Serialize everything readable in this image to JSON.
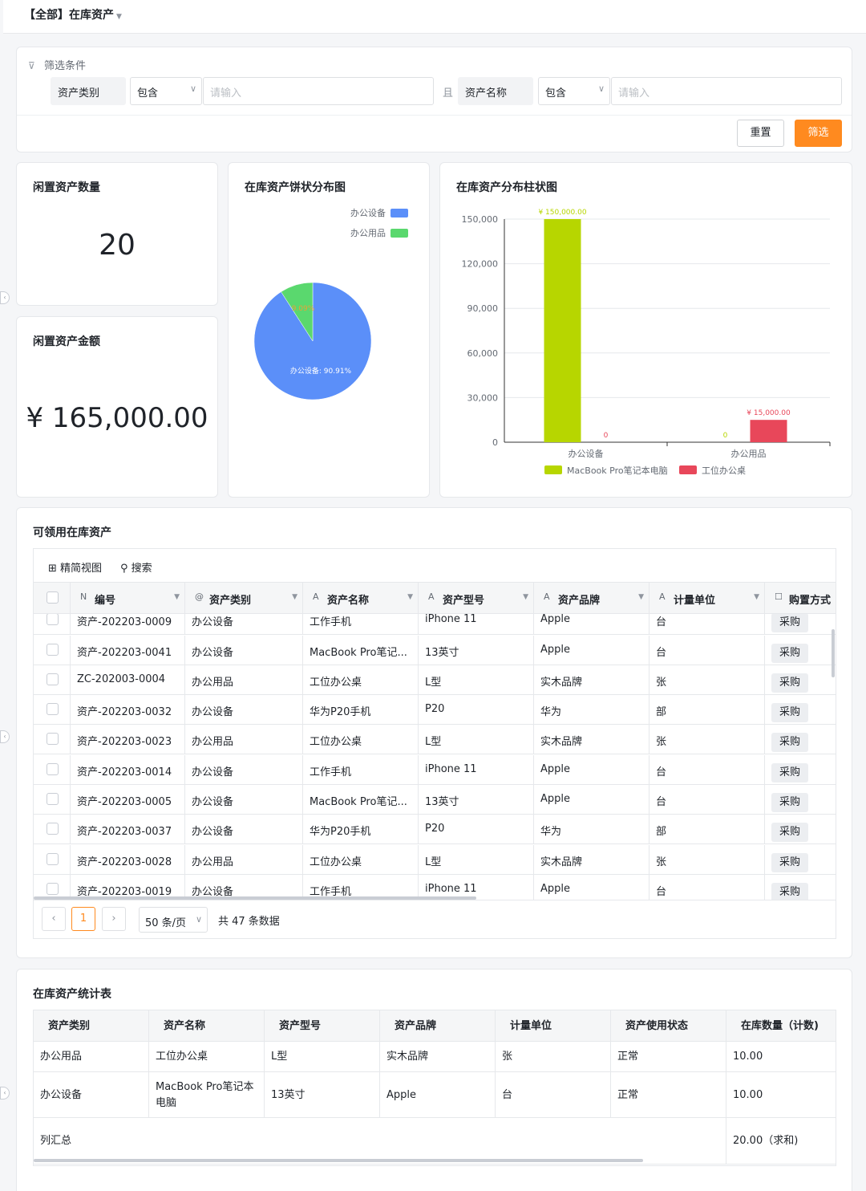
{
  "page": {
    "title": "【全部】在库资产"
  },
  "filter": {
    "label": "筛选条件",
    "connector": "且",
    "conditions": [
      {
        "field": "资产类别",
        "operator": "包含",
        "placeholder": "请输入"
      },
      {
        "field": "资产名称",
        "operator": "包含",
        "placeholder": "请输入"
      }
    ],
    "reset_label": "重置",
    "apply_label": "筛选"
  },
  "kpis": {
    "idle_count": {
      "title": "闲置资产数量",
      "value": "20"
    },
    "idle_amount": {
      "title": "闲置资产金额",
      "value": "¥ 165,000.00"
    }
  },
  "pie": {
    "title": "在库资产饼状分布图",
    "chart_data": {
      "type": "pie",
      "slices": [
        {
          "name": "办公设备",
          "value": 90.91,
          "label": "办公设备: 90.91%",
          "color": "#5b8ff9"
        },
        {
          "name": "办公用品",
          "value": 9.09,
          "label": "9.09%",
          "color": "#5ad86e"
        }
      ],
      "legend_position": "top-right"
    }
  },
  "bar": {
    "title": "在库资产分布柱状图",
    "chart_data": {
      "type": "bar",
      "categories": [
        "办公设备",
        "办公用品"
      ],
      "series": [
        {
          "name": "MacBook Pro笔记本电脑",
          "values": [
            150000,
            0
          ],
          "labels": [
            "¥ 150,000.00",
            "0"
          ],
          "color": "#b7d600"
        },
        {
          "name": "工位办公桌",
          "values": [
            0,
            15000
          ],
          "labels": [
            "0",
            "¥ 15,000.00"
          ],
          "color": "#e8475a"
        }
      ],
      "ylim": [
        0,
        150000
      ],
      "yticks": [
        "0",
        "30,000",
        "60,000",
        "90,000",
        "120,000",
        "150,000"
      ],
      "grid": true,
      "legend_position": "bottom"
    }
  },
  "available": {
    "title": "可领用在库资产",
    "toolbar": {
      "view_label": "精简视图",
      "search_label": "搜索"
    },
    "columns": [
      "编号",
      "资产类别",
      "资产名称",
      "资产型号",
      "资产品牌",
      "计量单位",
      "购置方式"
    ],
    "rows": [
      [
        "资产-202203-0009",
        "办公设备",
        "工作手机",
        "iPhone 11",
        "Apple",
        "台",
        "采购"
      ],
      [
        "资产-202203-0041",
        "办公设备",
        "MacBook Pro笔记...",
        "13英寸",
        "Apple",
        "台",
        "采购"
      ],
      [
        "ZC-202003-0004",
        "办公用品",
        "工位办公桌",
        "L型",
        "实木品牌",
        "张",
        "采购"
      ],
      [
        "资产-202203-0032",
        "办公设备",
        "华为P20手机",
        "P20",
        "华为",
        "部",
        "采购"
      ],
      [
        "资产-202203-0023",
        "办公用品",
        "工位办公桌",
        "L型",
        "实木品牌",
        "张",
        "采购"
      ],
      [
        "资产-202203-0014",
        "办公设备",
        "工作手机",
        "iPhone 11",
        "Apple",
        "台",
        "采购"
      ],
      [
        "资产-202203-0005",
        "办公设备",
        "MacBook Pro笔记...",
        "13英寸",
        "Apple",
        "台",
        "采购"
      ],
      [
        "资产-202203-0037",
        "办公设备",
        "华为P20手机",
        "P20",
        "华为",
        "部",
        "采购"
      ],
      [
        "资产-202203-0028",
        "办公用品",
        "工位办公桌",
        "L型",
        "实木品牌",
        "张",
        "采购"
      ],
      [
        "资产-202203-0019",
        "办公设备",
        "工作手机",
        "iPhone 11",
        "Apple",
        "台",
        "采购"
      ]
    ],
    "pager": {
      "current_page": "1",
      "page_size": "50 条/页",
      "total": "共 47 条数据"
    }
  },
  "stats": {
    "title": "在库资产统计表",
    "columns": [
      "资产类别",
      "资产名称",
      "资产型号",
      "资产品牌",
      "计量单位",
      "资产使用状态",
      "在库数量（计数)"
    ],
    "rows": [
      [
        "办公用品",
        "工位办公桌",
        "L型",
        "实木品牌",
        "张",
        "正常",
        "10.00"
      ],
      [
        "办公设备",
        "MacBook Pro笔记本电脑",
        "13英寸",
        "Apple",
        "台",
        "正常",
        "10.00"
      ]
    ],
    "summary": {
      "label": "列汇总",
      "value": "20.00（求和)"
    }
  }
}
